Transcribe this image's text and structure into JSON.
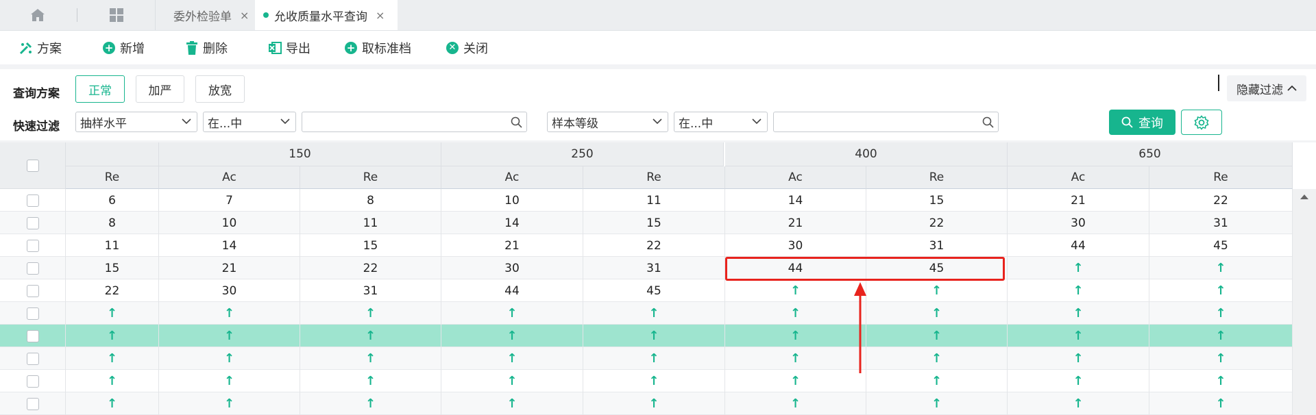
{
  "tabs": {
    "home_icon": "home-icon",
    "apps_icon": "grid-icon",
    "items": [
      {
        "label": "委外检验单",
        "active": false
      },
      {
        "label": "允收质量水平查询",
        "active": true
      }
    ],
    "close_glyph": "×"
  },
  "toolbar": {
    "scheme": "方案",
    "add": "新增",
    "delete": "删除",
    "export": "导出",
    "cancel_std": "取标准档",
    "close": "关闭"
  },
  "query": {
    "scheme_label": "查询方案",
    "schemes": [
      "正常",
      "加严",
      "放宽"
    ],
    "active_scheme": "正常",
    "hide_filter": "隐藏过滤",
    "quick_filter_label": "快速过滤",
    "filter1_field": "抽样水平",
    "filter1_op": "在...中",
    "filter1_value": "",
    "filter2_field": "样本等级",
    "filter2_op": "在...中",
    "filter2_value": "",
    "search_button": "查询"
  },
  "grid": {
    "groups": [
      "150",
      "250",
      "400",
      "650"
    ],
    "first_sub": "Re",
    "subs": [
      "Ac",
      "Re",
      "Ac",
      "Re",
      "Ac",
      "Re",
      "Ac",
      "Re"
    ],
    "rows": [
      [
        "6",
        "7",
        "8",
        "10",
        "11",
        "14",
        "15",
        "21",
        "22"
      ],
      [
        "8",
        "10",
        "11",
        "14",
        "15",
        "21",
        "22",
        "30",
        "31"
      ],
      [
        "11",
        "14",
        "15",
        "21",
        "22",
        "30",
        "31",
        "44",
        "45"
      ],
      [
        "15",
        "21",
        "22",
        "30",
        "31",
        "44",
        "45",
        "↑",
        "↑"
      ],
      [
        "22",
        "30",
        "31",
        "44",
        "45",
        "↑",
        "↑",
        "↑",
        "↑"
      ],
      [
        "↑",
        "↑",
        "↑",
        "↑",
        "↑",
        "↑",
        "↑",
        "↑",
        "↑"
      ],
      [
        "↑",
        "↑",
        "↑",
        "↑",
        "↑",
        "↑",
        "↑",
        "↑",
        "↑"
      ],
      [
        "↑",
        "↑",
        "↑",
        "↑",
        "↑",
        "↑",
        "↑",
        "↑",
        "↑"
      ],
      [
        "↑",
        "↑",
        "↑",
        "↑",
        "↑",
        "↑",
        "↑",
        "↑",
        "↑"
      ],
      [
        "↑",
        "↑",
        "↑",
        "↑",
        "↑",
        "↑",
        "↑",
        "↑",
        "↑"
      ]
    ],
    "selected_row": 6,
    "highlight": {
      "row": 3,
      "values": [
        "44",
        "45"
      ]
    }
  },
  "colors": {
    "accent": "#17b58e",
    "selected_row": "#9ee4cf",
    "annotation": "#e8231d"
  }
}
